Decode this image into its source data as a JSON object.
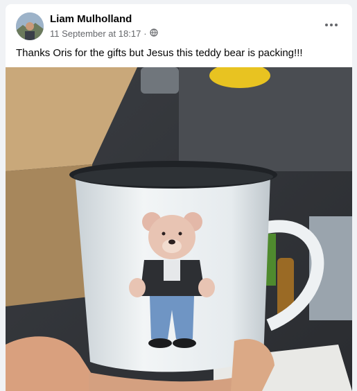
{
  "post": {
    "author": "Liam Mulholland",
    "date": "11 September at 18:17",
    "separator": "·",
    "privacy_icon": "globe-icon",
    "more_icon": "more-options-icon",
    "text": "Thanks Oris for the gifts but Jesus this teddy bear is packing!!!",
    "photo_subject": "enamel-mug-teddy-bear"
  },
  "colors": {
    "name": "#050505",
    "meta": "#65676b",
    "background": "#f0f2f5",
    "card": "#ffffff"
  }
}
